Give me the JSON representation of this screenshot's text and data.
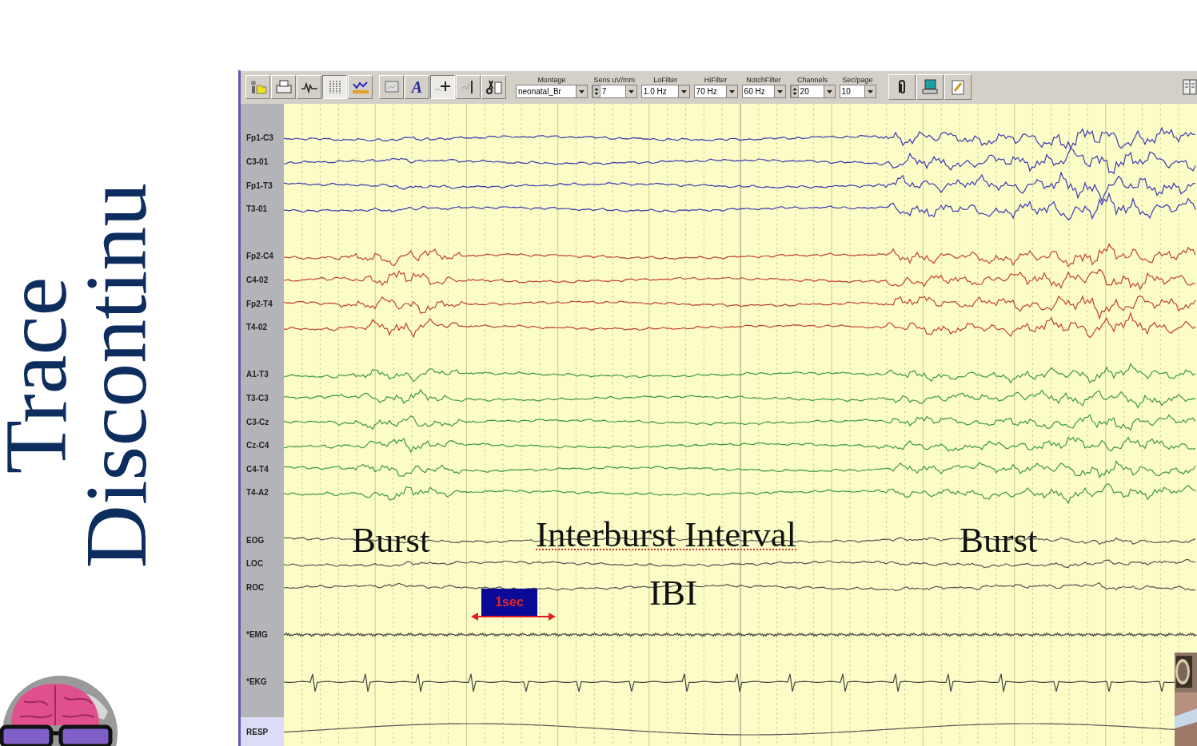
{
  "slide": {
    "title_lines": [
      "Trace",
      "Discontinu"
    ]
  },
  "toolbar": {
    "buttons": [
      {
        "pressed": false
      },
      {
        "pressed": false
      },
      {
        "pressed": false
      },
      {
        "pressed": true
      },
      {
        "pressed": false
      },
      {
        "pressed": false
      },
      {
        "pressed": false,
        "glyph": "A"
      },
      {
        "pressed": true
      },
      {
        "pressed": false
      },
      {
        "pressed": false
      }
    ],
    "fields": [
      {
        "label": "Montage",
        "value": "neonatal_Br",
        "spinner": false
      },
      {
        "label": "Sens uV/mm",
        "value": "7",
        "spinner": true
      },
      {
        "label": "LoFilter",
        "value": "1.0 Hz",
        "spinner": false
      },
      {
        "label": "HiFilter",
        "value": "70 Hz",
        "spinner": false
      },
      {
        "label": "NotchFilter",
        "value": "60 Hz",
        "spinner": false
      },
      {
        "label": "Channels",
        "value": "20",
        "spinner": true
      },
      {
        "label": "Sec/page",
        "value": "10",
        "spinner": false
      }
    ],
    "right_buttons": [
      {
        "pressed": false
      },
      {
        "pressed": false
      },
      {
        "pressed": false
      }
    ]
  },
  "channel_groups": [
    [
      {
        "label": "Fp1-C3",
        "kind": "eeg",
        "color": "#3a3ab4",
        "selected": false
      },
      {
        "label": "C3-01",
        "kind": "eeg",
        "color": "#3a3ab4",
        "selected": false
      },
      {
        "label": "Fp1-T3",
        "kind": "eeg",
        "color": "#3a3ab4",
        "selected": false
      },
      {
        "label": "T3-01",
        "kind": "eeg",
        "color": "#3a3ab4",
        "selected": false
      }
    ],
    [
      {
        "label": "Fp2-C4",
        "kind": "eeg",
        "color": "#c0442c",
        "selected": false
      },
      {
        "label": "C4-02",
        "kind": "eeg",
        "color": "#c0442c",
        "selected": false
      },
      {
        "label": "Fp2-T4",
        "kind": "eeg",
        "color": "#c0442c",
        "selected": false
      },
      {
        "label": "T4-02",
        "kind": "eeg",
        "color": "#c0442c",
        "selected": false
      }
    ],
    [
      {
        "label": "A1-T3",
        "kind": "eeg",
        "color": "#3c9a3c",
        "selected": false
      },
      {
        "label": "T3-C3",
        "kind": "eeg",
        "color": "#3c9a3c",
        "selected": false
      },
      {
        "label": "C3-Cz",
        "kind": "eeg",
        "color": "#3c9a3c",
        "selected": false
      },
      {
        "label": "Cz-C4",
        "kind": "eeg",
        "color": "#3c9a3c",
        "selected": false
      },
      {
        "label": "C4-T4",
        "kind": "eeg",
        "color": "#3c9a3c",
        "selected": false
      },
      {
        "label": "T4-A2",
        "kind": "eeg",
        "color": "#3c9a3c",
        "selected": false
      }
    ],
    [
      {
        "label": "EOG",
        "kind": "eog",
        "color": "#555555",
        "selected": false
      },
      {
        "label": "LOC",
        "kind": "eog",
        "color": "#555555",
        "selected": false
      },
      {
        "label": "ROC",
        "kind": "eog",
        "color": "#555555",
        "selected": false
      }
    ],
    [
      {
        "label": "*EMG",
        "kind": "emg",
        "color": "#444444",
        "selected": false
      }
    ],
    [
      {
        "label": "*EKG",
        "kind": "ekg",
        "color": "#444444",
        "selected": false
      }
    ],
    [
      {
        "label": "RESP",
        "kind": "resp",
        "color": "#555555",
        "selected": true
      }
    ]
  ],
  "annotations": [
    {
      "text": "Burst",
      "misspelled": false
    },
    {
      "text": "Interburst Interval",
      "misspelled": true
    },
    {
      "text": "Burst",
      "misspelled": false
    },
    {
      "text": "IBI",
      "misspelled": false
    }
  ],
  "scale_marker": {
    "text": "1sec"
  },
  "video": {
    "kind": "picture"
  }
}
